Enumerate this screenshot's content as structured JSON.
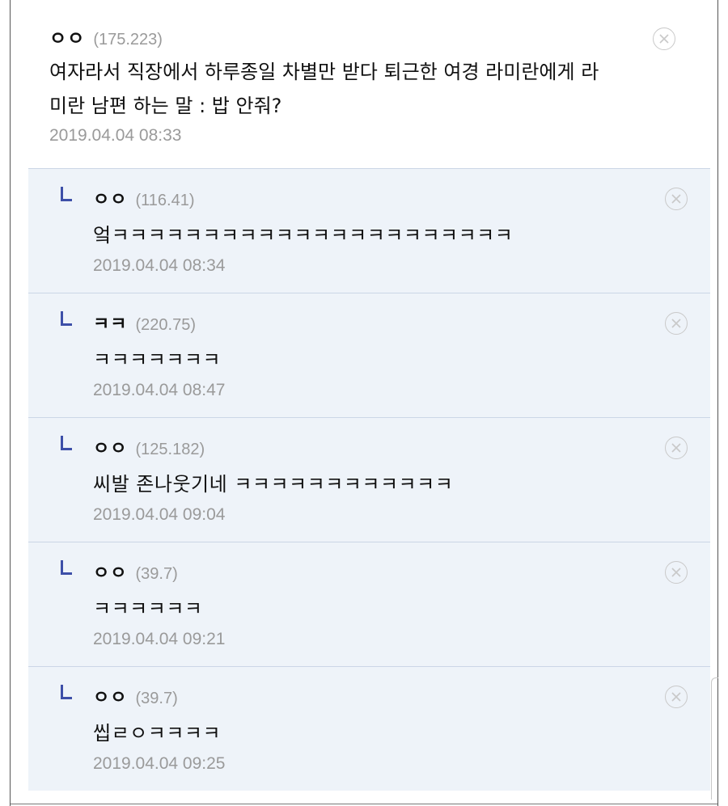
{
  "main_comment": {
    "nick": "ㅇㅇ",
    "ip": "(175.223)",
    "text_line1": "여자라서 직장에서 하루종일 차별만 받다 퇴근한 여경 라미란에게 라",
    "text_line2": "미란 남편 하는 말 : 밥 안줘?",
    "date": "2019.04.04 08:33",
    "close_icon": "circle-x-icon"
  },
  "replies": [
    {
      "nick": "ㅇㅇ",
      "ip": "(116.41)",
      "text": "엌ㅋㅋㅋㅋㅋㅋㅋㅋㅋㅋㅋㅋㅋㅋㅋㅋㅋㅋㅋㅋㅋㅋ",
      "date": "2019.04.04 08:34"
    },
    {
      "nick": "ㅋㅋ",
      "ip": "(220.75)",
      "text": "ㅋㅋㅋㅋㅋㅋㅋ",
      "date": "2019.04.04 08:47"
    },
    {
      "nick": "ㅇㅇ",
      "ip": "(125.182)",
      "text": "씨발 존나웃기네 ㅋㅋㅋㅋㅋㅋㅋㅋㅋㅋㅋㅋ",
      "date": "2019.04.04 09:04"
    },
    {
      "nick": "ㅇㅇ",
      "ip": "(39.7)",
      "text": "ㅋㅋㅋㅋㅋㅋ",
      "date": "2019.04.04 09:21"
    },
    {
      "nick": "ㅇㅇ",
      "ip": "(39.7)",
      "text": "씹ㄹㅇㅋㅋㅋㅋ",
      "date": "2019.04.04 09:25"
    }
  ],
  "colors": {
    "reply_bg": "#eef3f9",
    "hook": "#3d4fa8",
    "meta": "#9a9a9a"
  }
}
